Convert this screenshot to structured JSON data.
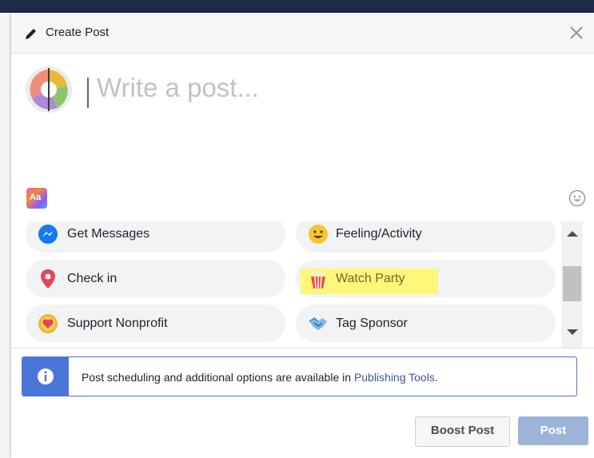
{
  "header": {
    "title": "Create Post"
  },
  "composer": {
    "placeholder": "Write a post..."
  },
  "options": [
    {
      "label": "Get Messages",
      "icon": "messenger-icon"
    },
    {
      "label": "Feeling/Activity",
      "icon": "smiley-face-icon"
    },
    {
      "label": "Check in",
      "icon": "location-pin-icon"
    },
    {
      "label": "Watch Party",
      "icon": "popcorn-icon"
    },
    {
      "label": "Support Nonprofit",
      "icon": "heart-coin-icon"
    },
    {
      "label": "Tag Sponsor",
      "icon": "handshake-icon"
    }
  ],
  "notice": {
    "text": "Post scheduling and additional options are available in ",
    "link": "Publishing Tools",
    "trailing": "."
  },
  "footer": {
    "boost_label": "Boost Post",
    "post_label": "Post"
  },
  "colors": {
    "accent": "#4a76d8",
    "post_disabled": "#9cb4d8",
    "highlight": "#fff67a",
    "link": "#385898"
  }
}
